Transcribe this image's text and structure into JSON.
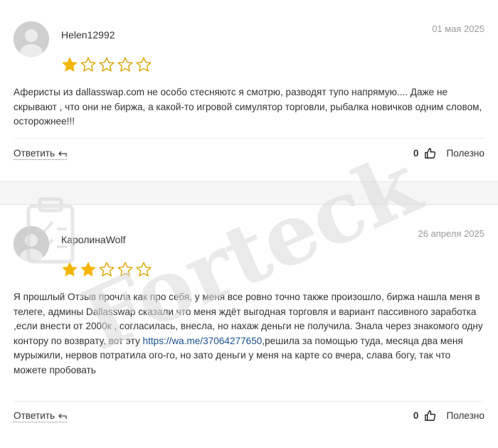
{
  "colors": {
    "star_filled": "#f2b600",
    "star_empty": "#d9a400",
    "link": "#1a4f8e",
    "date": "#9a9a9a",
    "watermark": "#d9d9d9"
  },
  "watermark": {
    "text": "Forteck"
  },
  "reviews": [
    {
      "author": "Helen12992",
      "date": "01 мая 2025",
      "rating": 1,
      "max_rating": 5,
      "text": "Аферисты из dallasswap.com не особо стесняютс я смотрю, разводят тупо напрямую.... Даже не скрывают , что они не биржа, а какой-то игровой симулятор торговли, рыбалка новичков одним словом, осторожнее!!!",
      "reply_label": "Ответить",
      "helpful_count": "0",
      "helpful_label": "Полезно"
    },
    {
      "author": "КаролинаWolf",
      "date": "26 апреля 2025",
      "rating": 2,
      "max_rating": 5,
      "text_before_link": "Я прошлый Отзыв прочла как про себя, у меня все ровно точно также произошло, биржа нашла меня в телеге, админы Dallasswap сказали что меня ждёт выгодная торговля и вариант пассивного заработка ,если внести от 2000к , согласилась, внесла, но нахаж деньги не получила. Знала через знакомого одну контору по возврату, вот эту ",
      "link_text": "https://wa.me/37064277650",
      "text_after_link": ",решила за помощью туда, месяца два меня мурыжили, нервов потратила ого-го, но зато деньги у меня на карте со вчера, слава богу, так что можете пробовать",
      "reply_label": "Ответить",
      "helpful_count": "0",
      "helpful_label": "Полезно"
    }
  ]
}
